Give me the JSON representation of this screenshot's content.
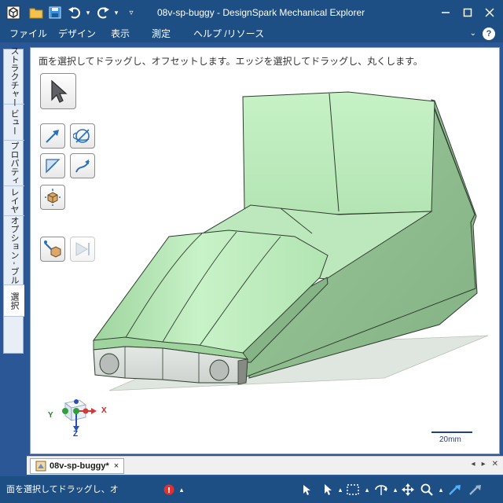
{
  "window": {
    "title": "08v-sp-buggy - DesignSpark Mechanical Explorer"
  },
  "menu": {
    "items": [
      "ファイル",
      "デザイン",
      "表示",
      "測定",
      "ヘルプ /リソース"
    ],
    "help_symbol": "?",
    "chevron": "⌄"
  },
  "side_tabs": [
    "ストラクチャー",
    "ビュー",
    "プロパティ",
    "レイヤ",
    "オプション - ブル",
    "選択"
  ],
  "viewport": {
    "hint": "面を選択してドラッグし、オフセットします。エッジを選択してドラッグし、丸くします。",
    "scale_label": "20mm",
    "triad": {
      "x": "X",
      "y": "Y",
      "z": "Z"
    }
  },
  "doc_tab": {
    "label": "08v-sp-buggy*",
    "close": "×"
  },
  "status": {
    "text": "面を選択してドラッグし、オ"
  },
  "colors": {
    "chrome": "#1e4f84",
    "model_light": "#c8f0c8",
    "model_mid": "#a8d8a8",
    "model_dark": "#88b488",
    "front_panel": "#d9ddd9"
  }
}
